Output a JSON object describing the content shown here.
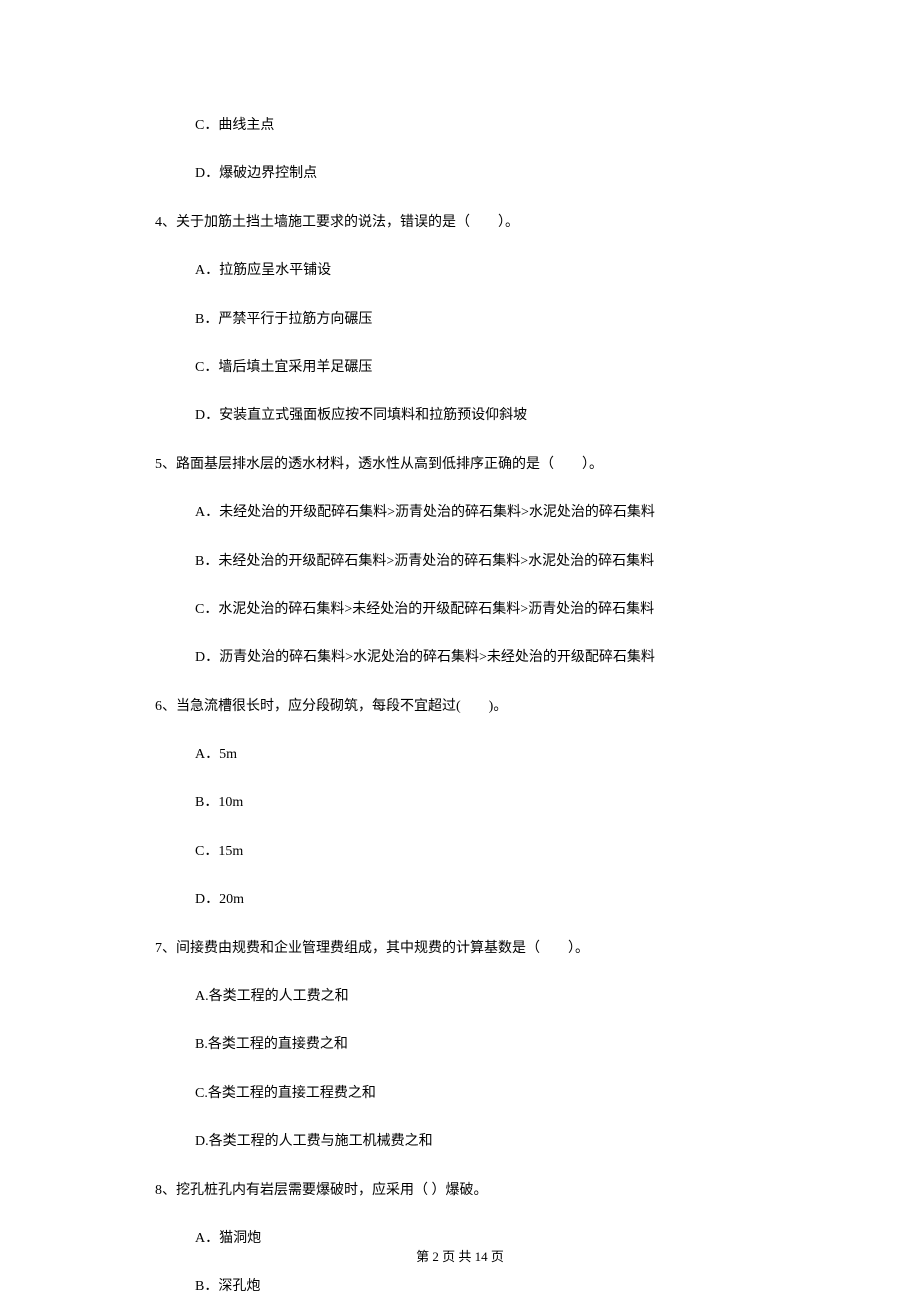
{
  "partial_q3": {
    "options": [
      "C．曲线主点",
      "D．爆破边界控制点"
    ]
  },
  "q4": {
    "stem": "4、关于加筋土挡土墙施工要求的说法，错误的是（　　）。",
    "options": [
      "A．拉筋应呈水平铺设",
      "B．严禁平行于拉筋方向碾压",
      "C．墙后填土宜采用羊足碾压",
      "D．安装直立式强面板应按不同填料和拉筋预设仰斜坡"
    ]
  },
  "q5": {
    "stem": "5、路面基层排水层的透水材料，透水性从高到低排序正确的是（　　）。",
    "options": [
      "A．未经处治的开级配碎石集料>沥青处治的碎石集料>水泥处治的碎石集料",
      "B．未经处治的开级配碎石集料>沥青处治的碎石集料>水泥处治的碎石集料",
      "C．水泥处治的碎石集料>未经处治的开级配碎石集料>沥青处治的碎石集料",
      "D．沥青处治的碎石集料>水泥处治的碎石集料>未经处治的开级配碎石集料"
    ]
  },
  "q6": {
    "stem": "6、当急流槽很长时，应分段砌筑，每段不宜超过(　　)。",
    "options": [
      "A．5m",
      "B．10m",
      "C．15m",
      "D．20m"
    ]
  },
  "q7": {
    "stem": "7、间接费由规费和企业管理费组成，其中规费的计算基数是（　　）。",
    "options": [
      "A.各类工程的人工费之和",
      "B.各类工程的直接费之和",
      "C.各类工程的直接工程费之和",
      "D.各类工程的人工费与施工机械费之和"
    ]
  },
  "q8": {
    "stem": "8、挖孔桩孔内有岩层需要爆破时，应采用（  ）爆破。",
    "options": [
      "A．猫洞炮",
      "B．深孔炮"
    ]
  },
  "footer": "第 2 页 共 14 页"
}
